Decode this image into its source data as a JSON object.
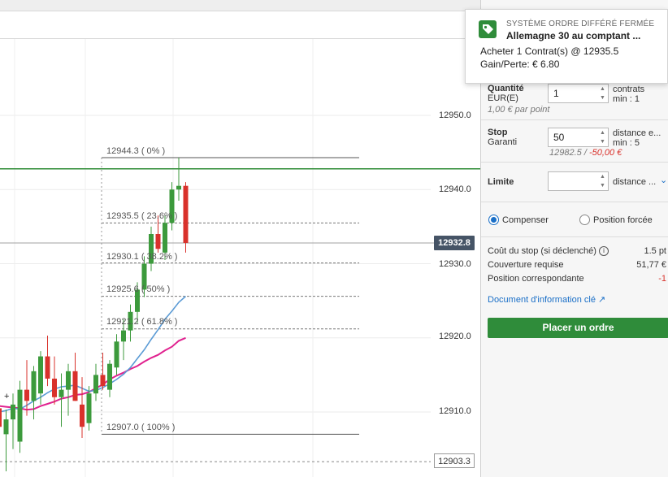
{
  "chart": {
    "price_ticks": [
      "12950.0",
      "12940.0",
      "12930.0",
      "12920.0",
      "12910.0"
    ],
    "current_price": "12932.8",
    "low_price": "12903.3",
    "fib_levels": [
      {
        "label": "12944.3 ( 0% )"
      },
      {
        "label": "12935.5 ( 23.6% )"
      },
      {
        "label": "12930.1 ( 38.2% )"
      },
      {
        "label": "12925.6 ( 50% )"
      },
      {
        "label": "12921.2 ( 61.8% )"
      },
      {
        "label": "12907.0 ( 100% )"
      }
    ],
    "colors": {
      "up": "#3c9a3c",
      "down": "#d9312b",
      "ma_fast": "#5b9bd5",
      "ma_slow": "#e0228f",
      "order_line": "#2e8b35"
    }
  },
  "chart_data": {
    "type": "candlestick",
    "ylim": [
      12901,
      12960
    ],
    "price_ticks": [
      12950.0,
      12940.0,
      12930.0,
      12920.0,
      12910.0
    ],
    "current_price": 12932.8,
    "low_marker": 12903.3,
    "order_line": 12942.8,
    "fibonacci": [
      {
        "pct": "0%",
        "price": 12944.3
      },
      {
        "pct": "23.6%",
        "price": 12935.5
      },
      {
        "pct": "38.2%",
        "price": 12930.1
      },
      {
        "pct": "50%",
        "price": 12925.6
      },
      {
        "pct": "61.8%",
        "price": 12921.2
      },
      {
        "pct": "100%",
        "price": 12907.0
      }
    ],
    "candles": [
      {
        "o": 12910.5,
        "h": 12912.8,
        "l": 12906.0,
        "c": 12908.0
      },
      {
        "o": 12907.0,
        "h": 12910.3,
        "l": 12902.0,
        "c": 12909.0
      },
      {
        "o": 12909.0,
        "h": 12912.5,
        "l": 12905.0,
        "c": 12911.0
      },
      {
        "o": 12906.0,
        "h": 12914.2,
        "l": 12904.5,
        "c": 12913.0
      },
      {
        "o": 12913.0,
        "h": 12917.0,
        "l": 12909.5,
        "c": 12911.5
      },
      {
        "o": 12911.5,
        "h": 12916.2,
        "l": 12909.0,
        "c": 12915.5
      },
      {
        "o": 12912.5,
        "h": 12918.2,
        "l": 12911.0,
        "c": 12917.5
      },
      {
        "o": 12917.5,
        "h": 12920.3,
        "l": 12913.5,
        "c": 12914.5
      },
      {
        "o": 12914.5,
        "h": 12917.5,
        "l": 12911.0,
        "c": 12912.0
      },
      {
        "o": 12912.0,
        "h": 12915.2,
        "l": 12908.0,
        "c": 12913.0
      },
      {
        "o": 12913.0,
        "h": 12916.5,
        "l": 12909.5,
        "c": 12915.5
      },
      {
        "o": 12915.5,
        "h": 12918.0,
        "l": 12911.5,
        "c": 12911.5
      },
      {
        "o": 12911.0,
        "h": 12914.7,
        "l": 12906.5,
        "c": 12908.0
      },
      {
        "o": 12908.5,
        "h": 12913.5,
        "l": 12907.5,
        "c": 12912.5
      },
      {
        "o": 12912.5,
        "h": 12916.5,
        "l": 12911.5,
        "c": 12915.0
      },
      {
        "o": 12915.0,
        "h": 12918.0,
        "l": 12913.0,
        "c": 12913.5
      },
      {
        "o": 12913.0,
        "h": 12917.0,
        "l": 12912.0,
        "c": 12916.5
      },
      {
        "o": 12916.0,
        "h": 12920.5,
        "l": 12915.0,
        "c": 12919.5
      },
      {
        "o": 12919.5,
        "h": 12922.5,
        "l": 12917.0,
        "c": 12921.0
      },
      {
        "o": 12921.0,
        "h": 12924.5,
        "l": 12919.5,
        "c": 12923.5
      },
      {
        "o": 12923.5,
        "h": 12927.5,
        "l": 12922.0,
        "c": 12926.5
      },
      {
        "o": 12926.5,
        "h": 12931.0,
        "l": 12925.5,
        "c": 12930.0
      },
      {
        "o": 12930.0,
        "h": 12935.0,
        "l": 12929.0,
        "c": 12934.0
      },
      {
        "o": 12934.0,
        "h": 12936.5,
        "l": 12931.5,
        "c": 12932.0
      },
      {
        "o": 12931.5,
        "h": 12936.5,
        "l": 12930.5,
        "c": 12935.5
      },
      {
        "o": 12935.5,
        "h": 12941.0,
        "l": 12934.5,
        "c": 12940.0
      },
      {
        "o": 12940.0,
        "h": 12944.3,
        "l": 12938.5,
        "c": 12940.5
      },
      {
        "o": 12940.5,
        "h": 12941.0,
        "l": 12931.5,
        "c": 12932.8
      }
    ],
    "ma_fast": [
      12910.0,
      12910.2,
      12910.5,
      12910.4,
      12910.9,
      12911.5,
      12912.0,
      12912.6,
      12913.1,
      12913.4,
      12913.5,
      12913.6,
      12913.2,
      12912.8,
      12912.9,
      12913.3,
      12913.8,
      12914.4,
      12915.1,
      12916.0,
      12917.2,
      12918.4,
      12919.8,
      12921.1,
      12922.5,
      12923.6,
      12924.8,
      12925.6
    ],
    "ma_slow": [
      12910.8,
      12910.7,
      12910.6,
      12910.5,
      12910.3,
      12910.4,
      12910.8,
      12911.1,
      12911.4,
      12911.8,
      12912.0,
      12912.3,
      12912.4,
      12912.7,
      12913.2,
      12913.7,
      12914.4,
      12914.9,
      12915.3,
      12915.8,
      12916.2,
      12916.8,
      12917.3,
      12917.7,
      12918.3,
      12918.8,
      12919.6,
      12920.0
    ]
  },
  "panel": {
    "quantity": {
      "label": "Quantité",
      "sub": "EUR(E)",
      "value": "1",
      "unit": "contrats",
      "min": "min : 1",
      "per_point": "1,00 € par point"
    },
    "stop": {
      "label": "Stop",
      "sub": "Garanti",
      "value": "50",
      "unit": "distance e...",
      "min": "min : 5",
      "level": "12982.5 /",
      "amount": "-50,00 €"
    },
    "limit": {
      "label": "Limite",
      "value": "",
      "unit": "distance ..."
    },
    "radio": {
      "compensate": "Compenser",
      "force_position": "Position forcée"
    },
    "stop_cost": {
      "label": "Coût du stop (si déclenché)",
      "value": "1.5 pt"
    },
    "margin": {
      "label": "Couverture requise",
      "value": "51,77 €"
    },
    "position": {
      "label": "Position correspondante",
      "value": "-1"
    },
    "doc_link": "Document d'information clé",
    "place_order": "Placer un ordre"
  },
  "notification": {
    "title": "SYSTÈME ORDRE DIFFÉRÉ FERMÉE",
    "instrument": "Allemagne 30 au comptant ...",
    "detail": "Acheter 1 Contrat(s) @ 12935.5",
    "pnl": "Gain/Perte: € 6.80"
  }
}
